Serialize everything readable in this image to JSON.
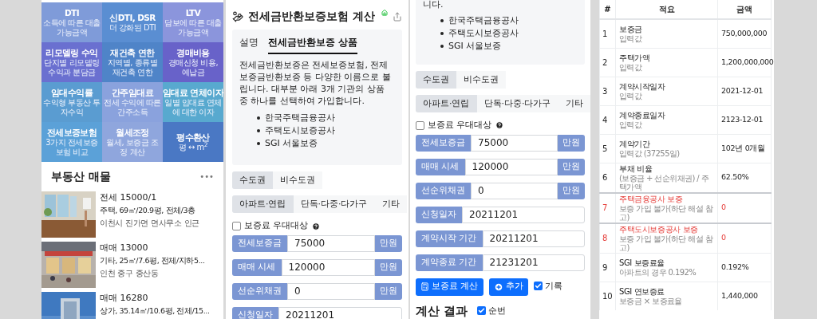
{
  "menu_screen": {
    "tiles": [
      {
        "title": "DTI",
        "description": "소득에 따른 대출 가능금액",
        "color": "#7f9bd9"
      },
      {
        "title": "신DTI, DSR",
        "description": "더 강화된 DTI",
        "color": "#5a8ed2"
      },
      {
        "title": "LTV",
        "description": "담보에 따른 대출 가능금액",
        "color": "#8b95dc"
      },
      {
        "title": "리모델링 수익",
        "description": "단지별 리모델링 수익과 분담금",
        "color": "#6a70d0"
      },
      {
        "title": "재건축 연한",
        "description": "지역별, 종류별 재건축 연한",
        "color": "#4f84c8"
      },
      {
        "title": "경매비용",
        "description": "경매신청 비용, 예납금",
        "color": "#6862c9"
      },
      {
        "title": "임대수익률",
        "description": "수익형 부동산 투자수익",
        "color": "#5a9cd1"
      },
      {
        "title": "간주임대료",
        "description": "전세 수익에 따른 간주소득",
        "color": "#8aa2dd"
      },
      {
        "title": "임대료 연체이자",
        "description": "일별 임대료 연체에 대한 이자",
        "color": "#58a9cf"
      },
      {
        "title": "전세보증보험",
        "description": "3가지 전세보증보험 비교",
        "color": "#5ba1d8"
      },
      {
        "title": "월세조정",
        "description": "월세, 보증금 조정 계산",
        "color": "#8fa6dd"
      },
      {
        "title": "평수환산",
        "description": "평 ↔ m$^{2}$",
        "color": "#4a78c4"
      }
    ],
    "listings_title": "부동산 매물",
    "more": "•••",
    "listings": [
      {
        "title": "전세 15000/1",
        "detail": "주택, 69㎡/20.9평, 전체/3층",
        "location": "이천시 진가면 면사무소 인근",
        "kind": "picture"
      },
      {
        "title": "매매 13000",
        "detail": "기타, 25㎡/7.6평, 전체/지하5...",
        "location": "인천 중구 중산동",
        "kind": "picture"
      },
      {
        "title": "매매 16280",
        "detail": "상가, 35.14㎡/10.6평, 전체/15...",
        "kind": "picture"
      }
    ]
  },
  "calculator_screen": {
    "title": "전세금반환보증보험 계산",
    "info_tabs": [
      {
        "label": "설명",
        "selected": false
      },
      {
        "label": "전세금반환보증 상품",
        "selected": true
      }
    ],
    "paragraph": "전세금반환보증은 전세보증보험, 전제보증금반환보증 등 다양한 이름으로 불립니다. 대부분 아래 3개 기관의 상품 중 하나를 선택하여 가입합니다.",
    "bullets": [
      "한국주택금융공사",
      "주택도시보증공사",
      "SGI 서울보증"
    ],
    "region_options": [
      {
        "label": "수도권",
        "selected": true
      },
      {
        "label": "비수도권",
        "selected": false
      }
    ],
    "housing_options": [
      {
        "label": "아파트·연립",
        "selected": true
      },
      {
        "label": "단독·다중·다가구",
        "selected": false
      },
      {
        "label": "기타",
        "selected": false
      }
    ],
    "discount": {
      "label": "보증료 우대대상",
      "checked": false
    },
    "fields": [
      {
        "label": "전세보증금",
        "value": "75000",
        "unit": "만원"
      },
      {
        "label": "매매 시세",
        "value": "120000",
        "unit": "만원"
      },
      {
        "label": "선순위채권",
        "value": "0",
        "unit": "만원"
      },
      {
        "label": "신청일자",
        "value": "20211201"
      }
    ]
  },
  "calculator_scrolled": {
    "paragraph_end": "니다.",
    "bullets": [
      "한국주택금융공사",
      "주택도시보증공사",
      "SGI 서울보증"
    ],
    "region_options": [
      {
        "label": "수도권",
        "selected": true
      },
      {
        "label": "비수도권",
        "selected": false
      }
    ],
    "housing_options": [
      {
        "label": "아파트·연립",
        "selected": true
      },
      {
        "label": "단독·다중·다가구",
        "selected": false
      },
      {
        "label": "기타",
        "selected": false
      }
    ],
    "discount": {
      "label": "보증료 우대대상",
      "checked": false
    },
    "fields": [
      {
        "label": "전세보증금",
        "value": "75000",
        "unit": "만원"
      },
      {
        "label": "매매 시세",
        "value": "120000",
        "unit": "만원"
      },
      {
        "label": "선순위채권",
        "value": "0",
        "unit": "만원"
      },
      {
        "label": "신청일자",
        "value": "20211201"
      },
      {
        "label": "계약시작 기간",
        "value": "20211201"
      },
      {
        "label": "계약종료 기간",
        "value": "21231201"
      }
    ],
    "actions": [
      {
        "label": "보증료 계산",
        "kind": "calculate"
      },
      {
        "label": "추가",
        "kind": "add"
      }
    ],
    "record": {
      "label": "기록",
      "checked": true
    },
    "result_heading": "계산 결과",
    "numbering": {
      "label": "순번",
      "checked": true
    }
  },
  "results_table": {
    "columns": [
      "#",
      "적요",
      "금액"
    ],
    "rows": [
      {
        "number": "1",
        "item": "보증금",
        "note": "입력값",
        "amount": "750,000,000",
        "alert": false
      },
      {
        "number": "2",
        "item": "주택가액",
        "note": "입력값",
        "amount": "1,200,000,000",
        "alert": false
      },
      {
        "number": "3",
        "item": "계약시작일자",
        "note": "입력값",
        "amount": "2021-12-01",
        "alert": false
      },
      {
        "number": "4",
        "item": "계약종료일자",
        "note": "입력값",
        "amount": "2123-12-01",
        "alert": false
      },
      {
        "number": "5",
        "item": "계약기간",
        "note": "입력값 (37255일)",
        "amount": "102년 0개월",
        "alert": false
      },
      {
        "number": "6",
        "item": "부채 비율",
        "note": "(보증금 + 선순위채권) / 주택가액",
        "amount": "62.50%",
        "alert": false
      },
      {
        "number": "7",
        "item": "주택금융공사 보증",
        "note": "보증 가입 불가(하단 해설 참고)",
        "amount": "0",
        "alert": true
      },
      {
        "number": "8",
        "item": "주택도시보증공사 보증",
        "note": "보증 가입 불가(하단 해설 참고)",
        "amount": "0",
        "alert": true
      },
      {
        "number": "9",
        "item": "SGI 보증료율",
        "note": "아파트의 경우 0.192%",
        "amount": "0.192%",
        "alert": false
      },
      {
        "number": "10",
        "item": "SGI 연보증료",
        "note": "보증금 × 보증료율",
        "amount": "1,440,000",
        "alert": false
      }
    ]
  }
}
